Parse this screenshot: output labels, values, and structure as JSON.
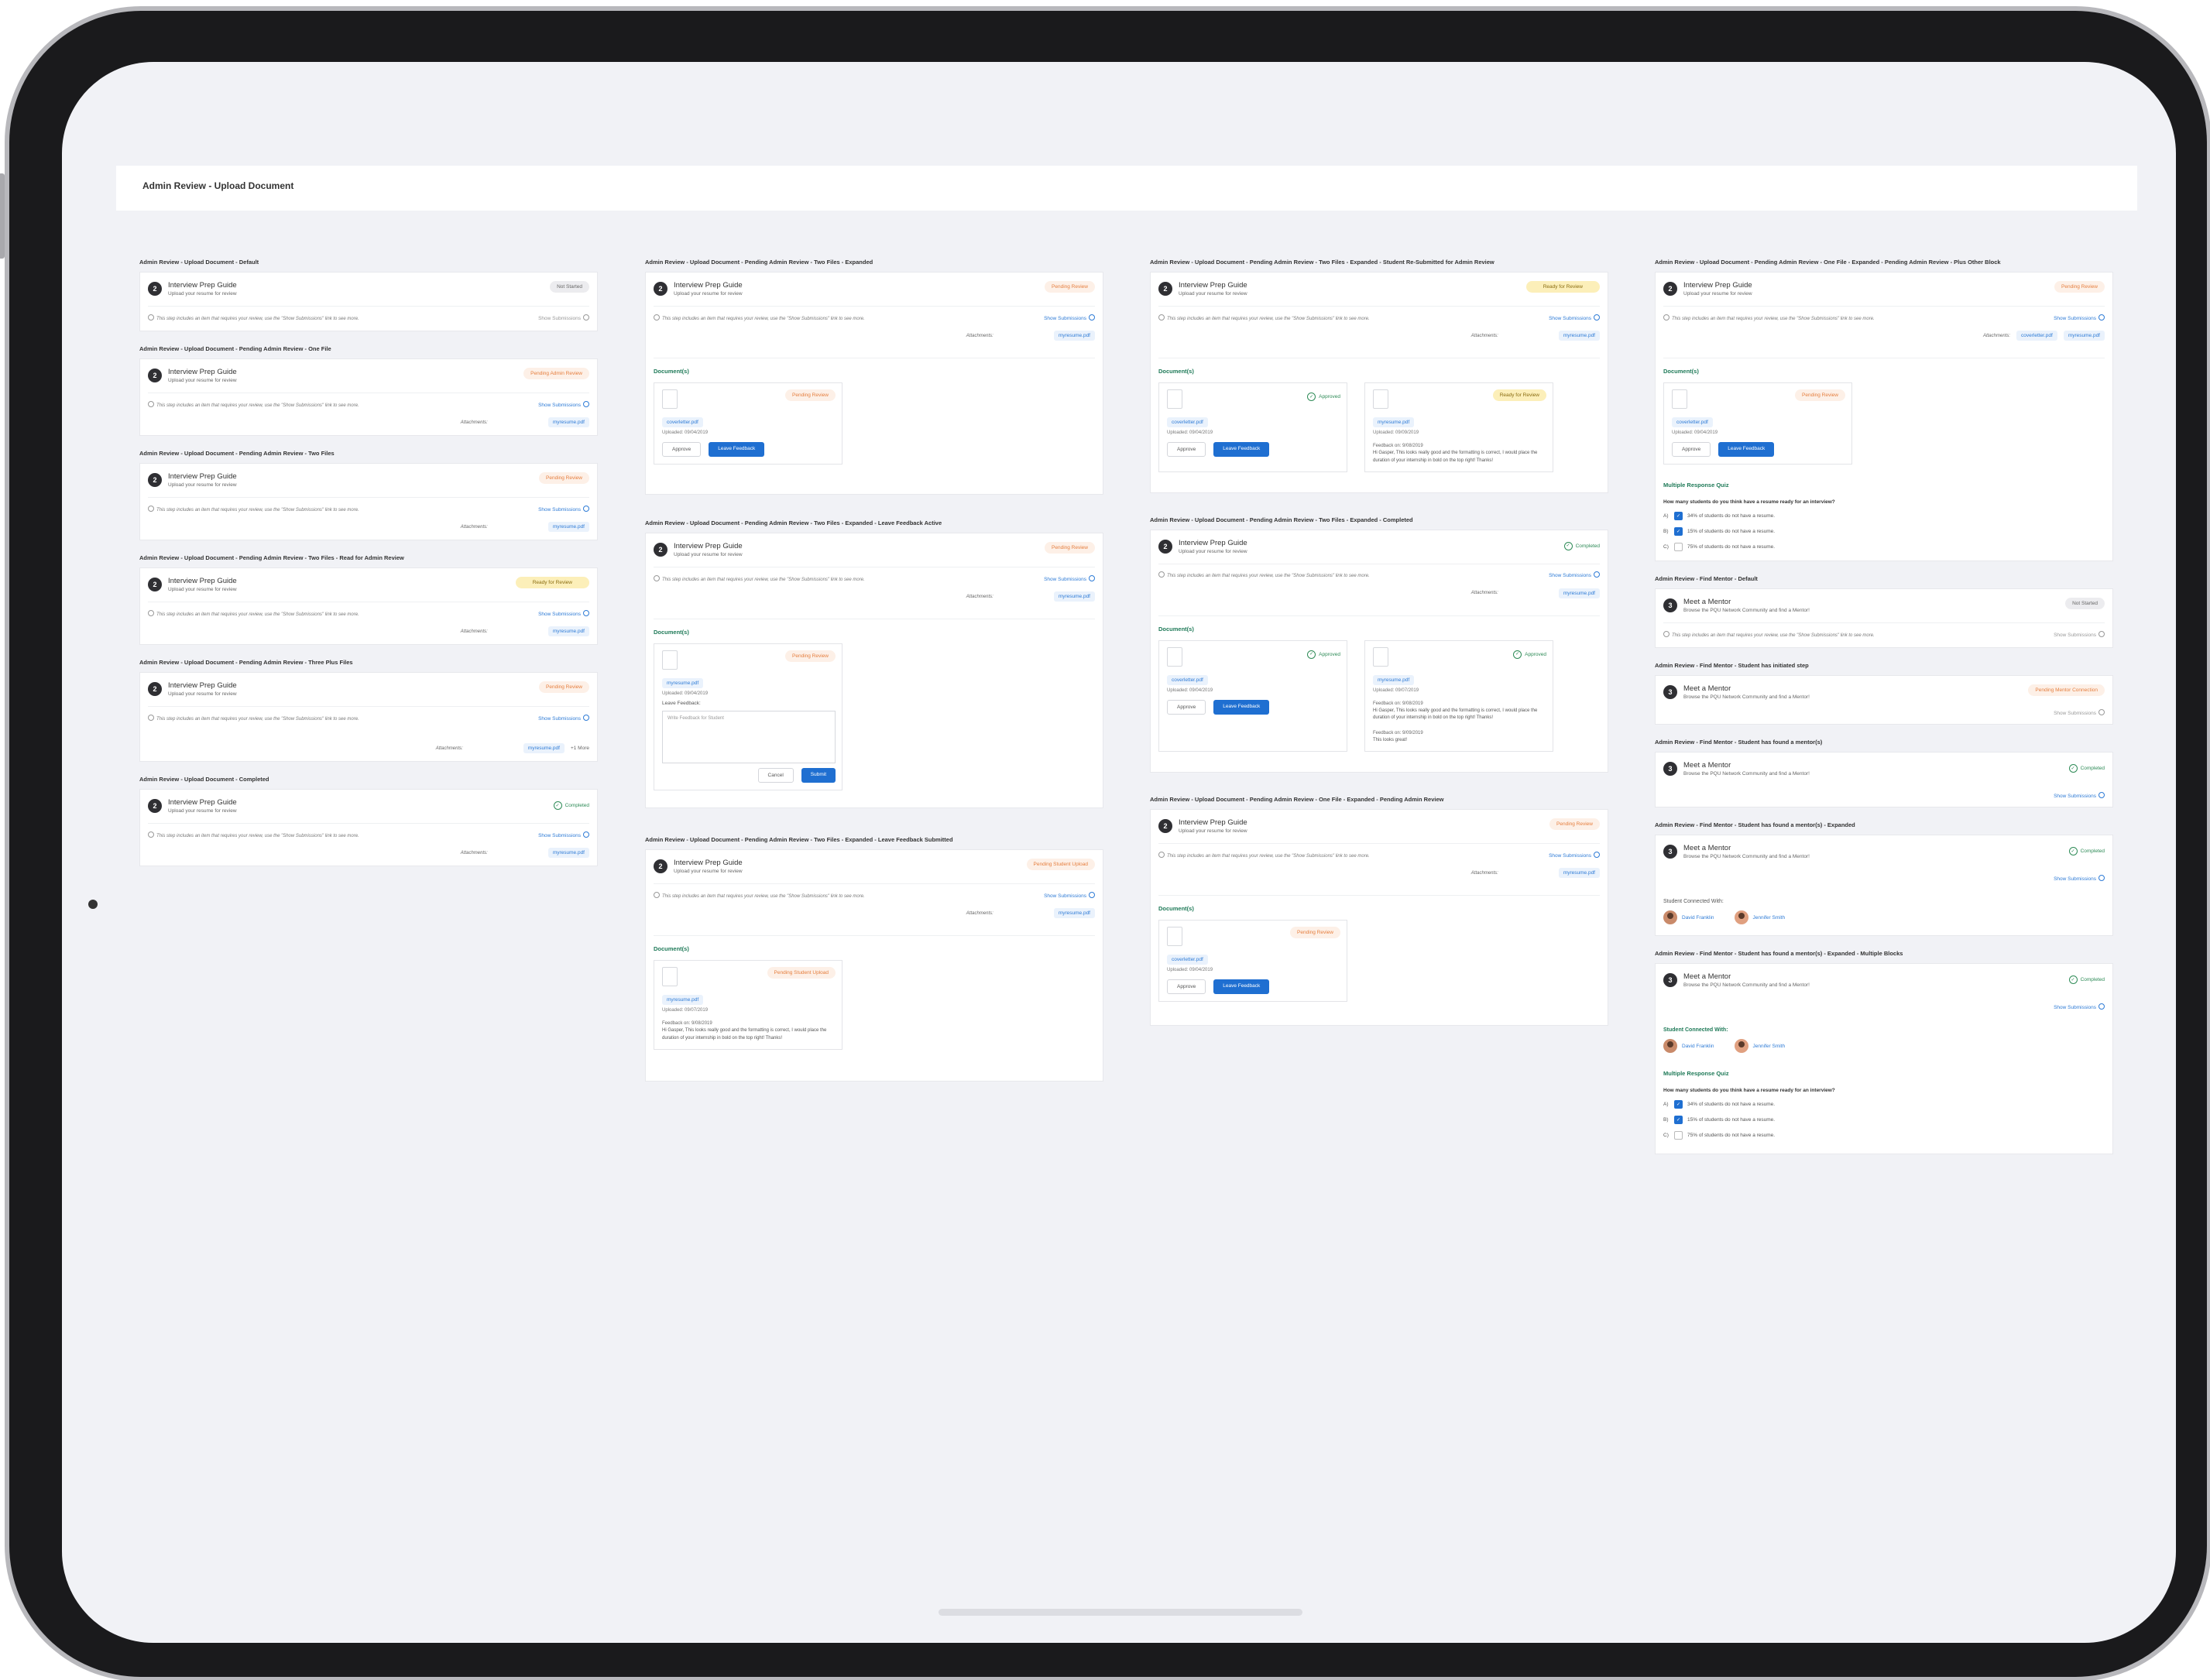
{
  "page_title": "Admin Review - Upload Document",
  "common": {
    "info_text": "This step includes an item that requires your review, use the \"Show Submissions\" link to see more.",
    "show_submissions": "Show Submissions",
    "attachments": "Attachments:",
    "documents": "Document(s)",
    "approve": "Approve",
    "leave_feedback": "Leave Feedback",
    "cancel": "Cancel",
    "submit": "Submit",
    "leave_feedback_label": "Leave Feedback:",
    "feedback_placeholder": "Write Feedback for Student",
    "more": "+1 More",
    "guide_title": "Interview Prep Guide",
    "guide_sub": "Upload your resume for review",
    "mentor_title": "Meet a Mentor",
    "mentor_sub": "Browse the PQU Network Community and find a Mentor!",
    "step2": "2",
    "step3": "3",
    "student_connected": "Student Connected With:",
    "person1": "David Franklin",
    "person2": "Jennifer Smith",
    "quiz_title": "Multiple Response Quiz",
    "quiz_question": "How many students do you think have a resume ready for an interview?",
    "opt_a_l": "A)",
    "opt_a": "34% of students do not have a resume.",
    "opt_b_l": "B)",
    "opt_b": "15% of students do not have a resume.",
    "opt_c_l": "C)",
    "opt_c": "75% of students do not have a resume.",
    "feedback_on_1": "Feedback on: 9/08/2019",
    "feedback_on_2": "Feedback on: 9/09/2019",
    "feedback_text": "Hi Gasper, This looks really good and the formatting is correct, I would place the duration of your internship in bold on the top right! Thanks!",
    "feedback_text_2": "This looks great!"
  },
  "status": {
    "not_started": "Not Started",
    "pending_admin": "Pending Admin Review",
    "pending_review": "Pending Review",
    "ready": "Ready for Review",
    "completed": "Completed",
    "pending_upload": "Pending Student Upload",
    "pending_mentor": "Pending Mentor Connection",
    "approved": "Approved"
  },
  "files": {
    "resume": "myresume.pdf",
    "cover": "coverletter.pdf",
    "up_0904": "Uploaded: 09/04/2019",
    "up_0909": "Uploaded: 09/09/2019",
    "up_0907": "Uploaded: 09/07/2019"
  },
  "labels": {
    "c1": [
      "Admin Review - Upload Document - Default",
      "Admin Review - Upload Document - Pending Admin Review - One File",
      "Admin Review - Upload Document - Pending Admin Review - Two Files",
      "Admin Review - Upload Document - Pending Admin Review - Two Files - Read for Admin Review",
      "Admin Review - Upload Document - Pending Admin Review - Three Plus Files",
      "Admin Review - Upload Document - Completed"
    ],
    "c2": [
      "Admin Review - Upload Document - Pending Admin Review - Two Files - Expanded",
      "Admin Review - Upload Document - Pending Admin Review - Two Files - Expanded - Leave Feedback Active",
      "Admin Review - Upload Document - Pending Admin Review - Two Files - Expanded - Leave Feedback Submitted"
    ],
    "c3": [
      "Admin Review - Upload Document - Pending Admin Review - Two Files - Expanded - Student Re-Submitted for Admin Review",
      "Admin Review - Upload Document - Pending Admin Review - Two Files - Expanded - Completed",
      "Admin Review - Upload Document - Pending Admin Review - One File - Expanded - Pending Admin Review"
    ],
    "c4": [
      "Admin Review - Upload Document - Pending Admin Review - One File - Expanded - Pending Admin Review - Plus Other Block",
      "Admin Review - Find Mentor - Default",
      "Admin Review - Find Mentor - Student has initiated step",
      "Admin Review - Find Mentor - Student has found a mentor(s)",
      "Admin Review - Find Mentor - Student has found a mentor(s) - Expanded",
      "Admin Review - Find Mentor - Student has found a mentor(s) - Expanded - Multiple Blocks"
    ]
  }
}
